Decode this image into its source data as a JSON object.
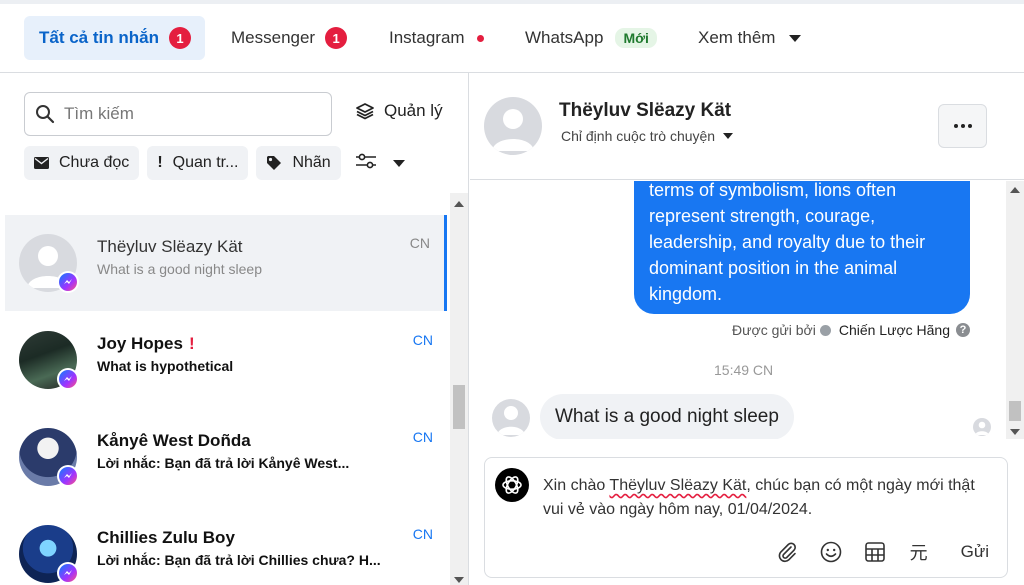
{
  "tabs": [
    {
      "label": "Tất cả tin nhắn",
      "badge": "1"
    },
    {
      "label": "Messenger",
      "badge": "1"
    },
    {
      "label": "Instagram"
    },
    {
      "label": "WhatsApp",
      "pill": "Mới"
    },
    {
      "label": "Xem thêm"
    }
  ],
  "search": {
    "placeholder": "Tìm kiếm"
  },
  "manage_label": "Quản lý",
  "filters": [
    "Chưa đọc",
    "Quan tr...",
    "Nhãn"
  ],
  "conversations": [
    {
      "name": "Thëyluv Slëazy Kät",
      "preview": "What is a good night sleep",
      "time": "CN",
      "selected": true,
      "unread": false
    },
    {
      "name": "Joy Hopes",
      "preview": "What is hypothetical",
      "time": "CN",
      "selected": false,
      "unread": true,
      "flag": "!"
    },
    {
      "name": "Kånyê West Doñda",
      "preview": "Lời nhắc: Bạn đã trả lời Kånyê West...",
      "time": "CN",
      "selected": false,
      "unread": true
    },
    {
      "name": "Chillies Zulu Boy",
      "preview": "Lời nhắc: Bạn đã trả lời Chillies chưa? H...",
      "time": "CN",
      "selected": false,
      "unread": true
    }
  ],
  "chat": {
    "title": "Thëyluv Slëazy Kät",
    "subtitle": "Chỉ định cuộc trò chuyện",
    "outgoing_text": "terms of symbolism, lions often represent strength, courage, leadership, and royalty due to their dominant position in the animal kingdom.",
    "sent_by_label": "Được gửi bởi",
    "sent_by_name": "Chiến Lược Hãng",
    "timestamp": "15:49 CN",
    "incoming_text": "What is a good night sleep"
  },
  "composer": {
    "text_before": "Xin chào ",
    "text_name": "Thëyluv Slëazy Kät",
    "text_after": ", chúc bạn có một ngày mới thật vui vẻ vào ngày hôm nay, 01/04/2024.",
    "currency_glyph": "元",
    "send_label": "Gửi"
  },
  "colors": {
    "accent": "#1877f2",
    "badge": "#e41e3f",
    "active_tab_bg": "#e7f0fb",
    "new_pill": "#e5f5e6"
  }
}
